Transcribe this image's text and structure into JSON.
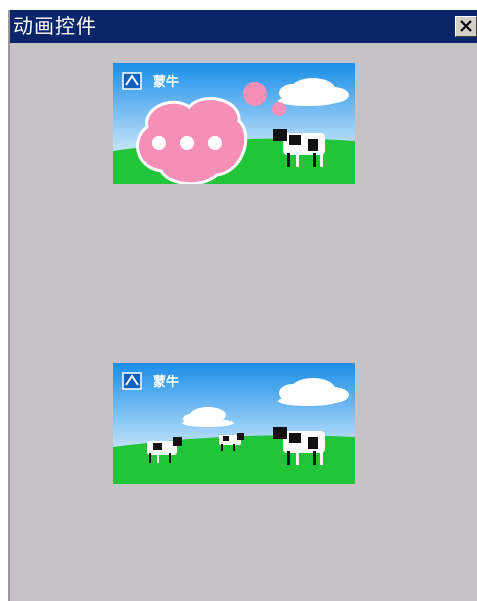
{
  "window": {
    "title": "动画控件",
    "colors": {
      "titlebar": "#0a246a",
      "client": "#c6c3c6"
    }
  },
  "banners": [
    {
      "brand": "蒙牛",
      "state": "loading-bubble"
    },
    {
      "brand": "蒙牛",
      "state": "cows-pasture"
    }
  ],
  "icons": {
    "close": "close-icon",
    "logo": "mengniu-logo-icon",
    "bubble": "thought-bubble-icon"
  }
}
